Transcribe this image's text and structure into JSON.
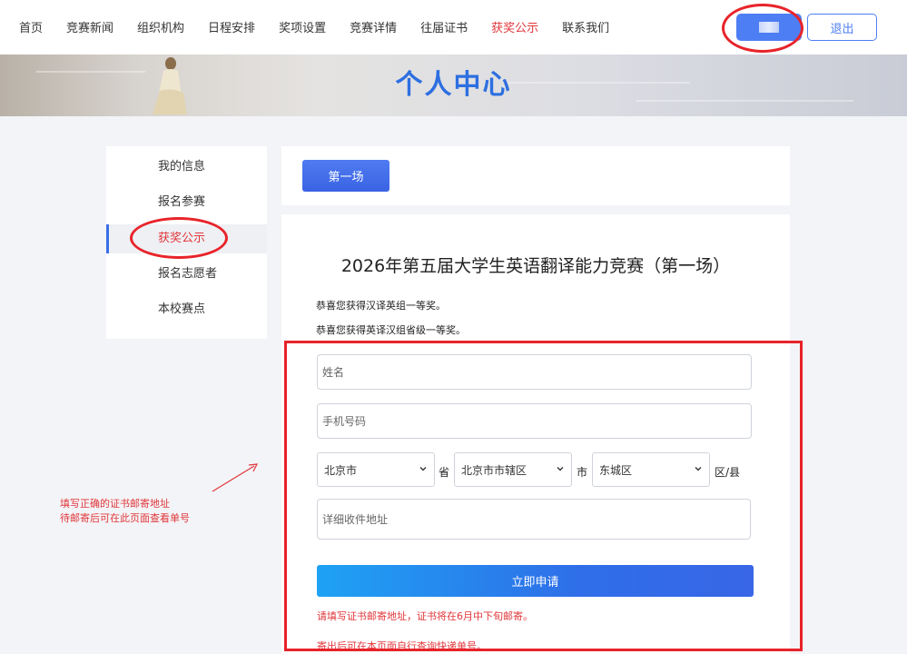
{
  "nav": {
    "items": [
      "首页",
      "竞赛新闻",
      "组织机构",
      "日程安排",
      "奖项设置",
      "竞赛详情",
      "往届证书",
      "获奖公示",
      "联系我们"
    ],
    "active_index": 7,
    "logout_label": "退出"
  },
  "banner": {
    "title": "个人中心"
  },
  "sidebar": {
    "items": [
      "我的信息",
      "报名参赛",
      "获奖公示",
      "报名志愿者",
      "本校赛点"
    ],
    "active_index": 2
  },
  "session": {
    "tab_label": "第一场"
  },
  "contest": {
    "title": "2026年第五届大学生英语翻译能力竞赛（第一场）",
    "awards": [
      "恭喜您获得汉译英组一等奖。",
      "恭喜您获得英译汉组省级一等奖。"
    ]
  },
  "form": {
    "name_placeholder": "姓名",
    "phone_placeholder": "手机号码",
    "province": "北京市",
    "province_suffix": "省",
    "city": "北京市市辖区",
    "city_suffix": "市",
    "district": "东城区",
    "district_suffix": "区/县",
    "address_placeholder": "详细收件地址",
    "submit_label": "立即申请",
    "notes": [
      "请填写证书邮寄地址，证书将在6月中下旬邮寄。",
      "寄出后可在本页面自行查询快递单号。"
    ]
  },
  "annotation": {
    "lines": [
      "填写正确的证书邮寄地址",
      "待邮寄后可在此页面查看单号"
    ]
  },
  "colors": {
    "accent": "#4e7ef3",
    "highlight_red": "#e8232a",
    "active_text": "#e0363a"
  }
}
